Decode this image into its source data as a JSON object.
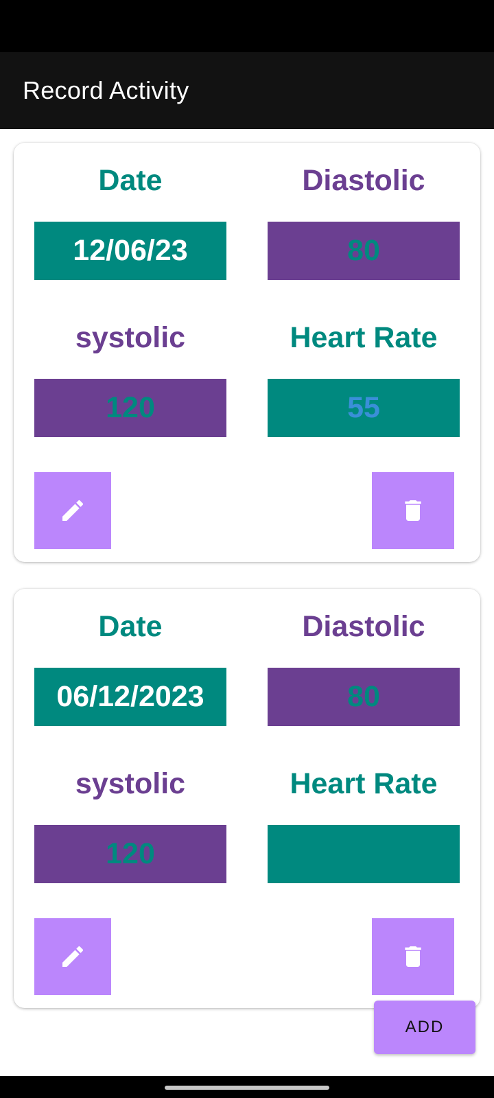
{
  "app_bar": {
    "title": "Record Activity"
  },
  "records": [
    {
      "date_label": "Date",
      "date_value": "12/06/23",
      "diastolic_label": "Diastolic",
      "diastolic_value": "80",
      "systolic_label": "systolic",
      "systolic_value": "120",
      "heart_rate_label": "Heart Rate",
      "heart_rate_value": "55",
      "edit_icon": "pencil-icon",
      "delete_icon": "trash-icon"
    },
    {
      "date_label": "Date",
      "date_value": "06/12/2023",
      "diastolic_label": "Diastolic",
      "diastolic_value": "80",
      "systolic_label": "systolic",
      "systolic_value": "120",
      "heart_rate_label": "Heart Rate",
      "heart_rate_value": "",
      "edit_icon": "pencil-icon",
      "delete_icon": "trash-icon"
    }
  ],
  "add_button": {
    "label": "ADD"
  },
  "colors": {
    "teal": "#00897f",
    "purple": "#6b3f91",
    "button": "#bb86fc",
    "app_bar": "#121212",
    "heart_rate_text": "#3a8fd8"
  }
}
